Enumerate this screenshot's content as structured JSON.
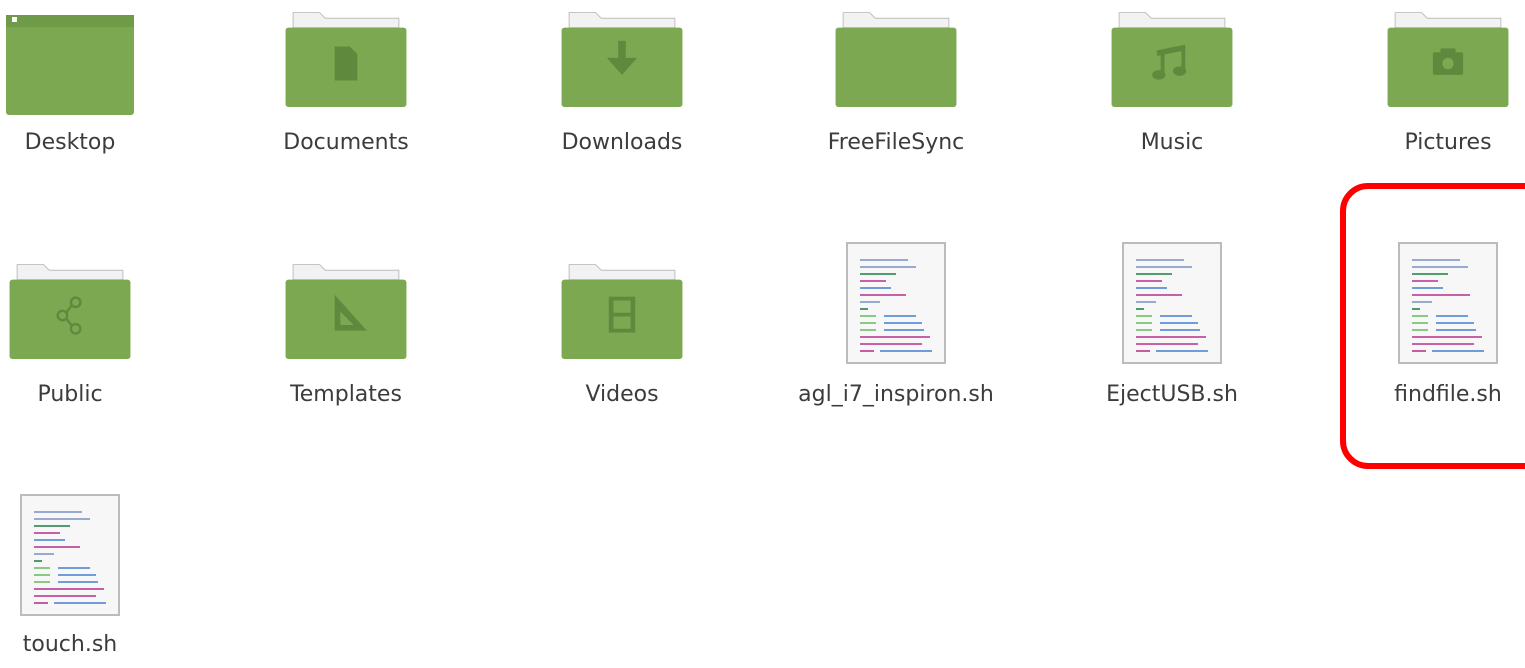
{
  "colors": {
    "folder_body": "#7ba851",
    "folder_back": "#f2f2f2",
    "folder_symbol": "#5f8a3e",
    "highlight": "#ff0000",
    "label_text": "#3c3c3c"
  },
  "items": [
    {
      "name": "Desktop",
      "type": "folder",
      "icon": "desktop-folder-icon"
    },
    {
      "name": "Documents",
      "type": "folder",
      "icon": "documents-folder-icon"
    },
    {
      "name": "Downloads",
      "type": "folder",
      "icon": "downloads-folder-icon"
    },
    {
      "name": "FreeFileSync",
      "type": "folder",
      "icon": "folder-icon"
    },
    {
      "name": "Music",
      "type": "folder",
      "icon": "music-folder-icon"
    },
    {
      "name": "Pictures",
      "type": "folder",
      "icon": "pictures-folder-icon"
    },
    {
      "name": "Public",
      "type": "folder",
      "icon": "public-folder-icon"
    },
    {
      "name": "Templates",
      "type": "folder",
      "icon": "templates-folder-icon"
    },
    {
      "name": "Videos",
      "type": "folder",
      "icon": "videos-folder-icon"
    },
    {
      "name": "agl_i7_inspiron.sh",
      "type": "script",
      "icon": "shell-script-icon"
    },
    {
      "name": "EjectUSB.sh",
      "type": "script",
      "icon": "shell-script-icon"
    },
    {
      "name": "findfile.sh",
      "type": "script",
      "icon": "shell-script-icon",
      "highlighted": true
    },
    {
      "name": "touch.sh",
      "type": "script",
      "icon": "shell-script-icon"
    }
  ]
}
